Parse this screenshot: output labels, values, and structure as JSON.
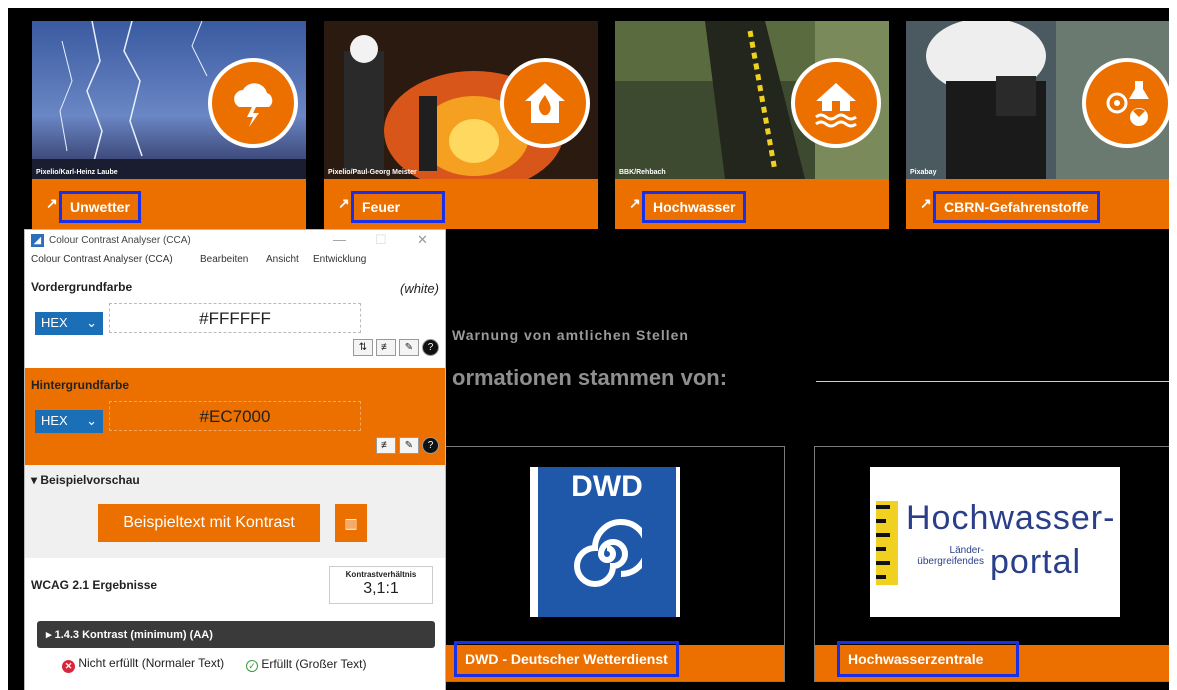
{
  "tiles": [
    {
      "label": "Unwetter",
      "credit": "Pixelio/Karl-Heinz Laube",
      "icon": "thunderstorm-icon"
    },
    {
      "label": "Feuer",
      "credit": "Pixelio/Paul-Georg Meister",
      "icon": "house-fire-icon"
    },
    {
      "label": "Hochwasser",
      "credit": "BBK/Rehbach",
      "icon": "house-flood-icon"
    },
    {
      "label": "CBRN-Gefahrenstoffe",
      "credit": "Pixabay",
      "icon": "biohazard-radiation-icon"
    }
  ],
  "tile_arrow": "↗",
  "warning_text": "Warnung von amtlichen Stellen",
  "sources_heading": "ormationen stammen von:",
  "partners": [
    {
      "name": "DWD - Deutscher Wetterdienst",
      "logo_text": "DWD"
    },
    {
      "name": "Hochwasserzentrale",
      "logo_line1": "Hochwasser-",
      "logo_small1": "Länder-",
      "logo_small2": "übergreifendes",
      "logo_line2": "portal"
    }
  ],
  "cca": {
    "title": "Colour Contrast Analyser (CCA)",
    "menu": [
      "Colour Contrast Analyser (CCA)",
      "Bearbeiten",
      "Ansicht",
      "Entwicklung"
    ],
    "foreground": {
      "label": "Vordergrundfarbe",
      "name": "(white)",
      "format": "HEX",
      "value": "#FFFFFF"
    },
    "background": {
      "label": "Hintergrundfarbe",
      "format": "HEX",
      "value": "#EC7000"
    },
    "preview": {
      "label": "▾ Beispielvorschau",
      "sample": "Beispieltext mit Kontrast"
    },
    "results": {
      "label": "WCAG 2.1 Ergebnisse",
      "ratio_label": "Kontrastverhältnis",
      "ratio": "3,1:1",
      "criterion": "▸ 1.4.3 Kontrast (minimum) (AA)",
      "fail_text": "Nicht erfüllt (Normaler Text)",
      "pass_text": "Erfüllt (Großer Text)"
    }
  },
  "colors": {
    "accent": "#EC7000",
    "highlight": "#1A2FE8",
    "page_bg": "#000000"
  }
}
